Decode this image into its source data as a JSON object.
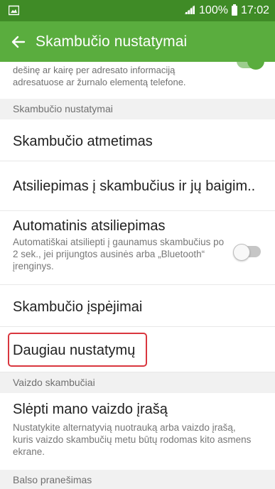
{
  "status_bar": {
    "battery": "100%",
    "time": "17:02",
    "icons": [
      "image-icon",
      "signal-icon",
      "battery-icon"
    ]
  },
  "app_bar": {
    "title": "Skambučio nustatymai",
    "back_icon": "back-arrow-icon"
  },
  "partial_item": {
    "description": "dešinę ar kairę per adresato informaciją adresatuose ar žurnalo elementą telefone."
  },
  "sections": [
    {
      "title": "Skambučio nustatymai"
    },
    {
      "title": "Vaizdo skambučiai"
    },
    {
      "title": "Balso pranešimas"
    }
  ],
  "items": [
    {
      "label": "Skambučio atmetimas"
    },
    {
      "label": "Atsiliepimas į skambučius ir jų baigim.."
    },
    {
      "label": "Automatinis atsiliepimas",
      "description": "Automatiškai atsiliepti į gaunamus skambučius po 2 sek., jei prijungtos ausinės arba „Bluetooth“ įrenginys.",
      "toggle": "off"
    },
    {
      "label": "Skambučio įspėjimai"
    },
    {
      "label": "Daugiau nustatymų"
    },
    {
      "label": "Slėpti mano vaizdo įrašą",
      "description": "Nustatykite alternatyvią nuotrauką arba vaizdo įrašą, kuris vaizdo skambučių metu būtų rodomas kito asmens ekrane."
    }
  ],
  "colors": {
    "status_bar": "#3f8b26",
    "app_bar": "#5aad3e",
    "section_bg": "#f1f1f1",
    "highlight": "#d9363e"
  }
}
